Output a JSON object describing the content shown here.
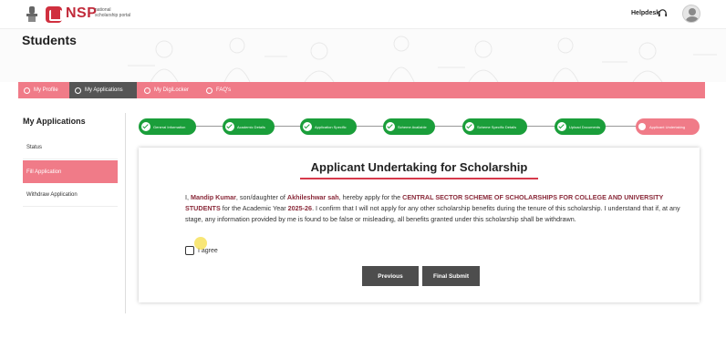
{
  "header": {
    "logo_text": "NSP",
    "logo_subtitle": "national scholarship portal",
    "helpdesk_label": "Helpdesk"
  },
  "page_title": "Students",
  "tabs": [
    {
      "label": "My Profile",
      "active": false,
      "icon": "user-icon"
    },
    {
      "label": "My Applications",
      "active": true,
      "icon": "check-circle-icon"
    },
    {
      "label": "My DigiLocker",
      "active": false,
      "icon": "lock-icon"
    },
    {
      "label": "FAQ's",
      "active": false,
      "icon": "chat-icon"
    }
  ],
  "sidebar": {
    "title": "My Applications",
    "items": [
      {
        "label": "Status",
        "active": false
      },
      {
        "label": "Fill Application",
        "active": true
      },
      {
        "label": "Withdraw Application",
        "active": false
      }
    ]
  },
  "stepper": {
    "steps": [
      {
        "label": "General Information",
        "status": "complete"
      },
      {
        "label": "Academic Details",
        "status": "complete"
      },
      {
        "label": "Application Specific",
        "status": "complete"
      },
      {
        "label": "Scheme Available",
        "status": "complete"
      },
      {
        "label": "Scheme Specific Details",
        "status": "complete"
      },
      {
        "label": "Upload Documents",
        "status": "complete"
      },
      {
        "label": "Applicant Undertaking",
        "status": "current"
      }
    ]
  },
  "card": {
    "title": "Applicant Undertaking for Scholarship",
    "text_prefix": "I, ",
    "applicant_name": "Mandip Kumar",
    "text_relation": ", son/daughter of ",
    "parent_name": "Akhileshwar sah",
    "text_apply": ", hereby apply for the ",
    "scheme_name": "CENTRAL SECTOR SCHEME OF SCHOLARSHIPS FOR COLLEGE AND UNIVERSITY STUDENTS",
    "text_year": " for the Academic Year ",
    "academic_year": "2025-26",
    "text_rest": ". I confirm that I will not apply for any other scholarship benefits during the tenure of this scholarship. I understand that if, at any stage, any information provided by me is found to be false or misleading, all benefits granted under this scholarship shall be withdrawn.",
    "agree_label": "I agree",
    "agree_checked": false,
    "previous_label": "Previous",
    "submit_label": "Final Submit"
  },
  "colors": {
    "accent_pink": "#f07b88",
    "active_dark": "#555555",
    "step_green": "#1a9e3a",
    "brand_red": "#c12a3a"
  }
}
